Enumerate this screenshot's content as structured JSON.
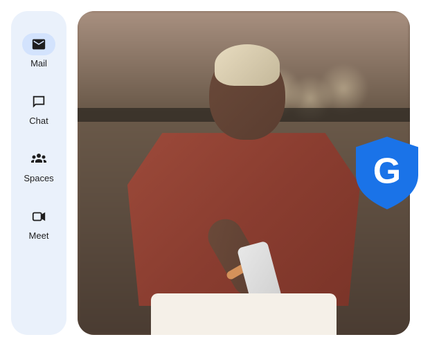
{
  "sidebar": {
    "items": [
      {
        "label": "Mail",
        "icon": "mail-icon",
        "active": true
      },
      {
        "label": "Chat",
        "icon": "chat-icon",
        "active": false
      },
      {
        "label": "Spaces",
        "icon": "spaces-icon",
        "active": false
      },
      {
        "label": "Meet",
        "icon": "meet-icon",
        "active": false
      }
    ]
  },
  "badge": {
    "letter": "G"
  }
}
